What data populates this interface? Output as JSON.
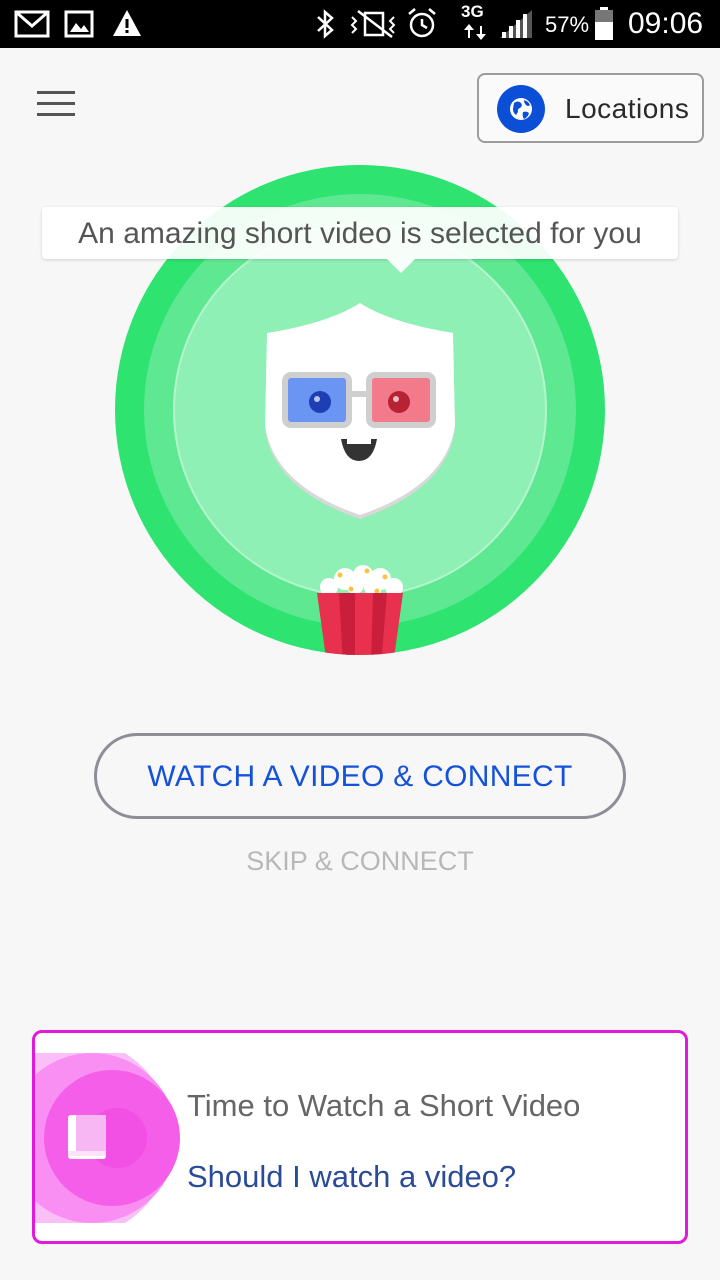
{
  "status_bar": {
    "battery_percent": "57%",
    "time": "09:06",
    "network": "3G",
    "icons": [
      "mail-icon",
      "image-icon",
      "warning-icon",
      "bluetooth-icon",
      "vibrate-icon",
      "alarm-icon",
      "signal-icon",
      "battery-icon"
    ]
  },
  "header": {
    "menu_icon": "hamburger-icon",
    "locations_label": "Locations",
    "locations_icon": "globe-icon"
  },
  "hero": {
    "tooltip": "An amazing short video is selected for you",
    "mascot_icon": "shield-mascot-3d-glasses",
    "popcorn_icon": "popcorn-icon"
  },
  "actions": {
    "watch_label": "WATCH A VIDEO & CONNECT",
    "skip_label": "SKIP & CONNECT"
  },
  "card": {
    "title": "Time to Watch a Short Video",
    "link": "Should I watch a video?",
    "icon": "book-icon"
  },
  "colors": {
    "green_outer": "#2ee06f",
    "green_inner": "#8ef0b4",
    "accent_blue": "#1552d8",
    "card_border": "#e01ad8"
  }
}
